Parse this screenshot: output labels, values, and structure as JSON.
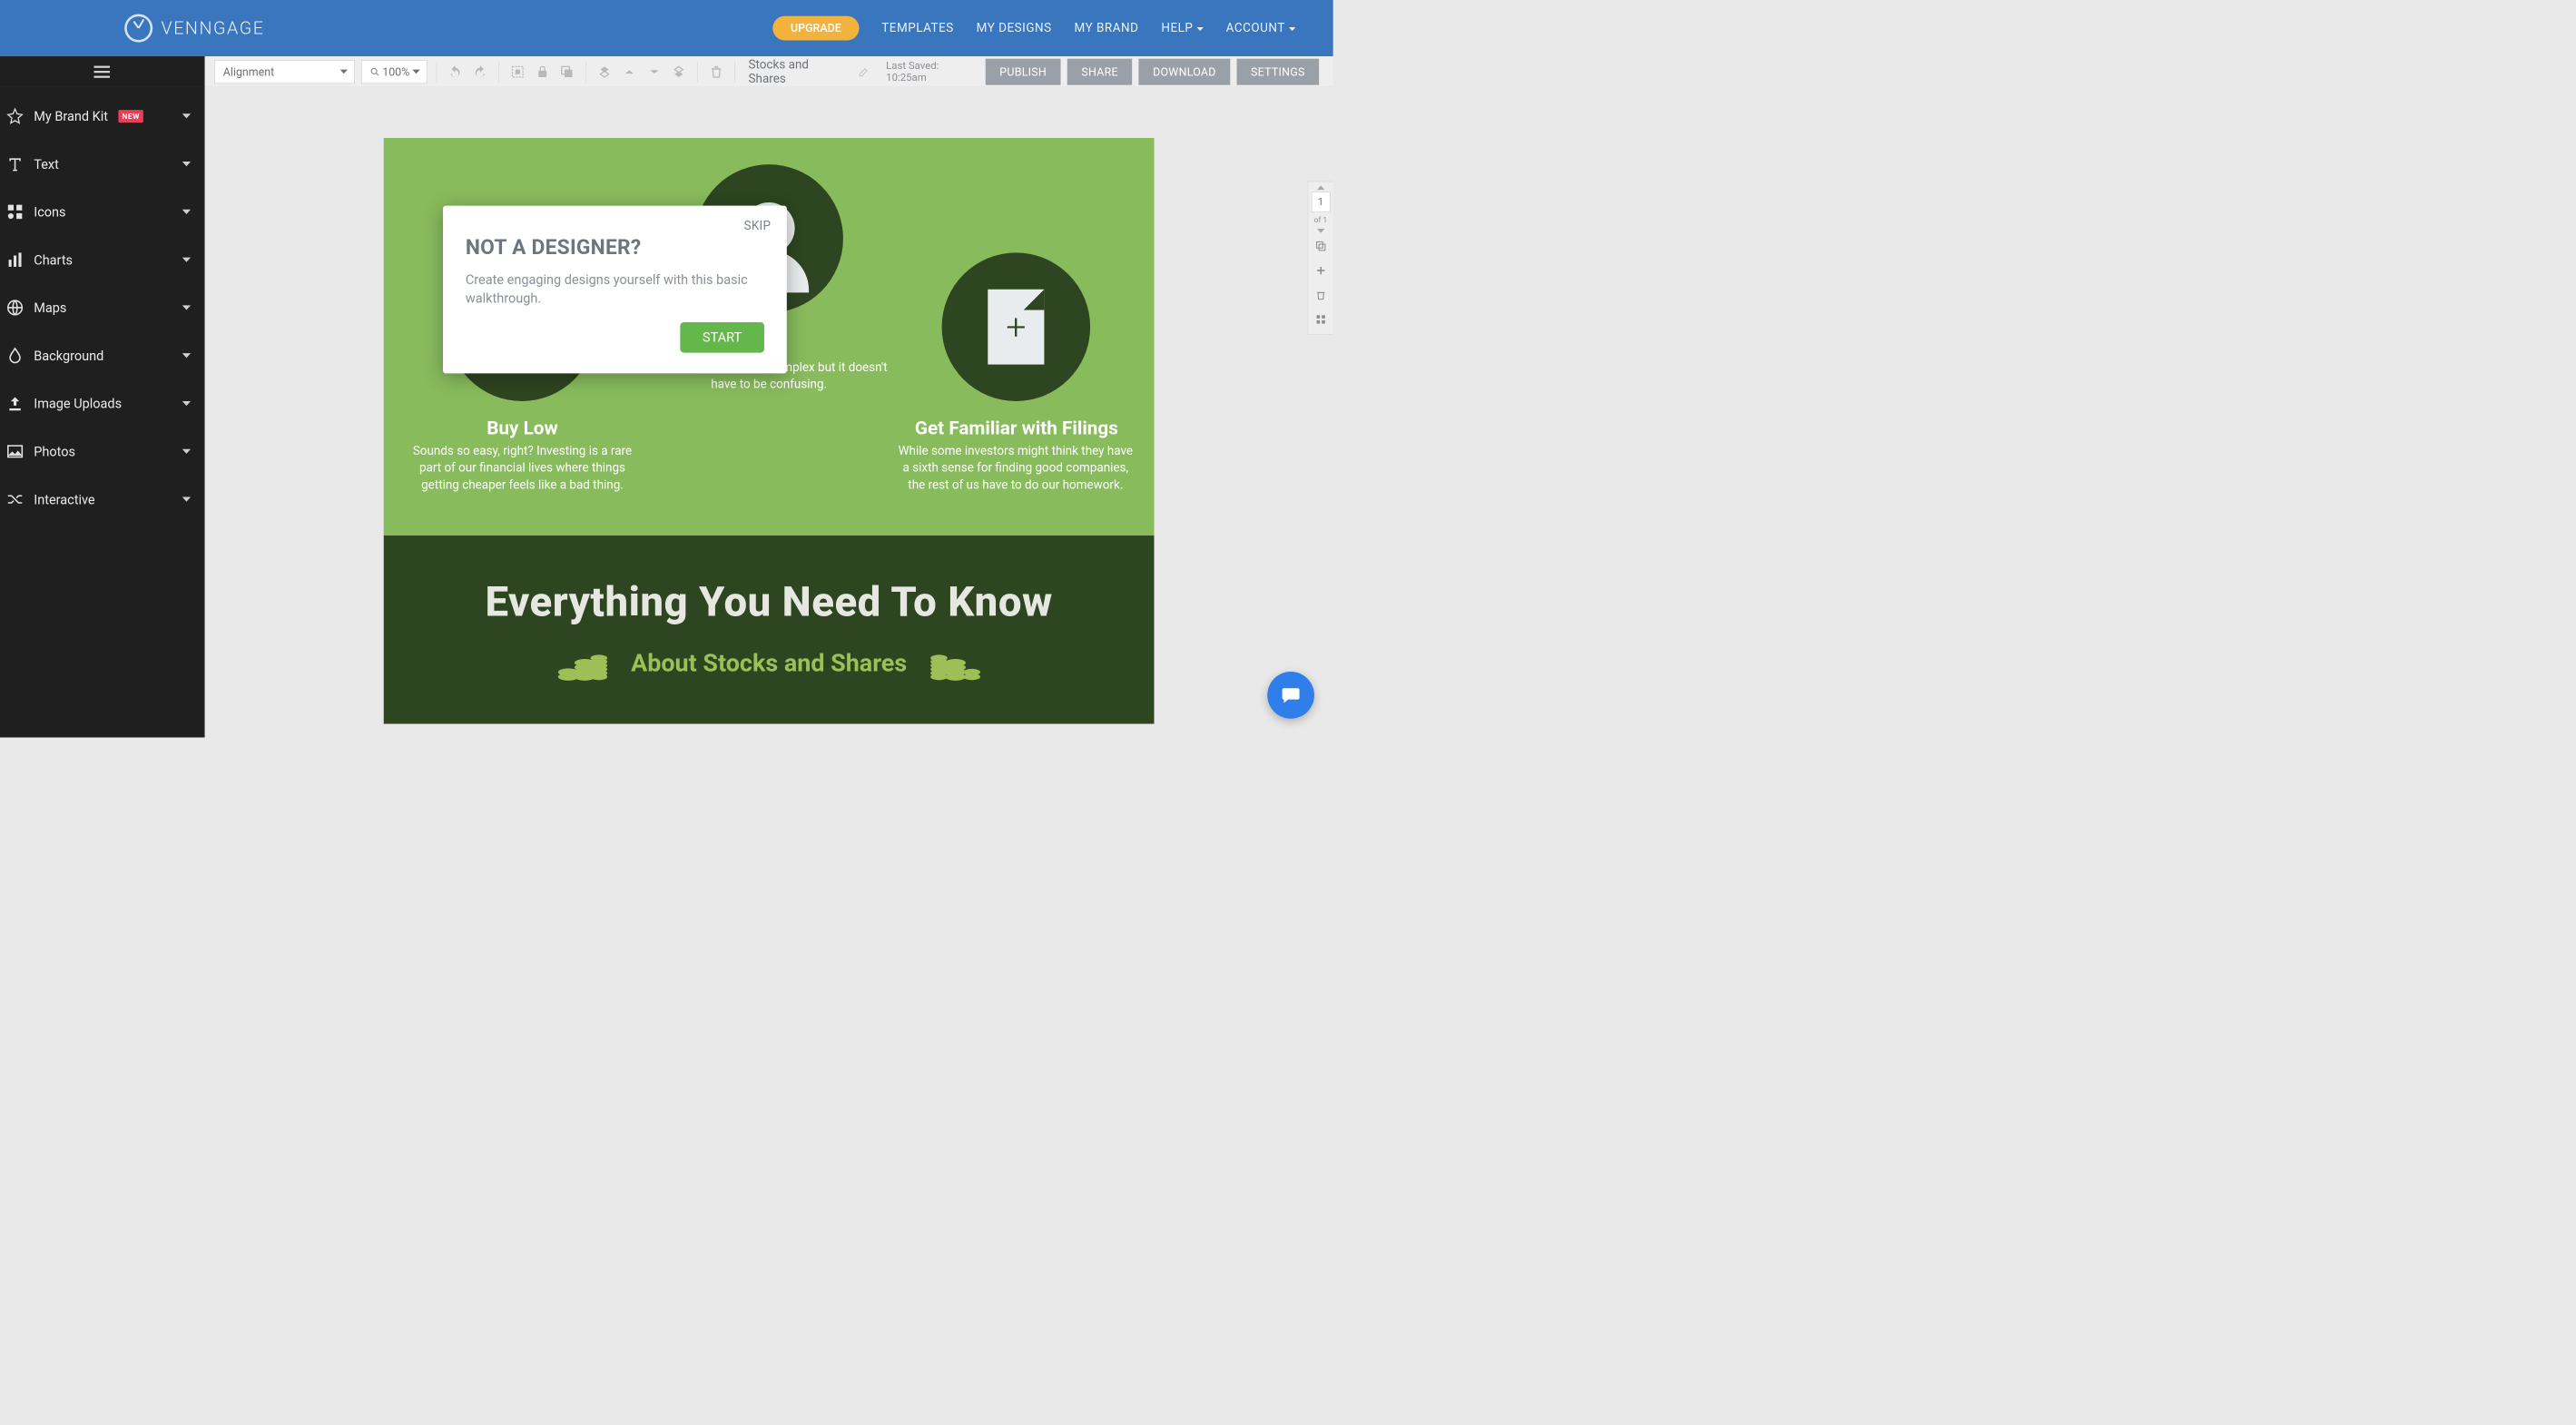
{
  "brand": {
    "name": "VENNGAGE"
  },
  "topnav": {
    "upgrade": "UPGRADE",
    "items": [
      {
        "label": "TEMPLATES",
        "dropdown": false
      },
      {
        "label": "MY DESIGNS",
        "dropdown": false
      },
      {
        "label": "MY BRAND",
        "dropdown": false
      },
      {
        "label": "HELP",
        "dropdown": true
      },
      {
        "label": "ACCOUNT",
        "dropdown": true
      }
    ]
  },
  "toolbar": {
    "alignment_label": "Alignment",
    "zoom_label": "100%",
    "doc_title": "Stocks and Shares",
    "last_saved": "Last Saved: 10:25am",
    "buttons": {
      "publish": "PUBLISH",
      "share": "SHARE",
      "download": "DOWNLOAD",
      "settings": "SETTINGS"
    }
  },
  "sidebar": {
    "items": [
      {
        "label": "My Brand Kit",
        "badge": "NEW"
      },
      {
        "label": "Text"
      },
      {
        "label": "Icons"
      },
      {
        "label": "Charts"
      },
      {
        "label": "Maps"
      },
      {
        "label": "Background"
      },
      {
        "label": "Image Uploads"
      },
      {
        "label": "Photos"
      },
      {
        "label": "Interactive"
      }
    ]
  },
  "canvas": {
    "left_title": "Buy Low",
    "left_desc": "Sounds so easy, right? Investing is a rare part of our financial lives where things getting cheaper feels like a bad thing.",
    "mid_desc": "The financial world is complex but it doesn't have to be confusing.",
    "right_title": "Get Familiar with Filings",
    "right_desc": "While some investors might think they have a sixth sense for finding good companies, the rest of us have to do our homework.",
    "bottom_heading": "Everything You Need To Know",
    "bottom_sub": "About Stocks and Shares"
  },
  "modal": {
    "skip": "SKIP",
    "title": "NOT A DESIGNER?",
    "body": "Create engaging designs yourself with this basic walkthrough.",
    "start": "START"
  },
  "right_tools": {
    "page_number": "1",
    "of_label": "of 1"
  }
}
